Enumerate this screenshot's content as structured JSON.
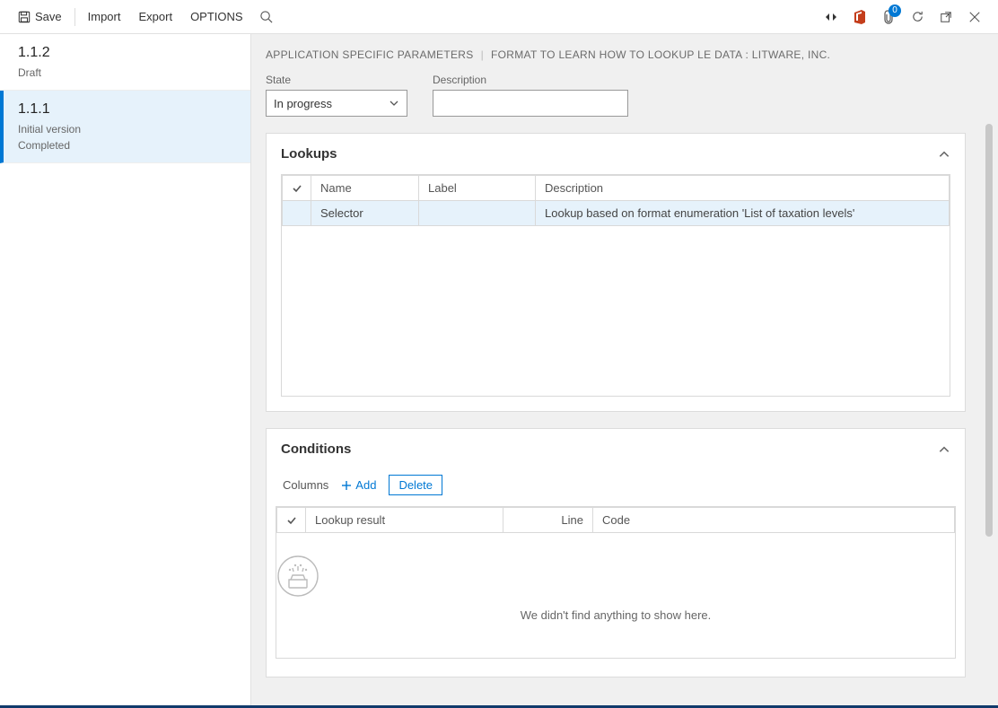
{
  "toolbar": {
    "save": "Save",
    "import": "Import",
    "export": "Export",
    "options": "OPTIONS",
    "badge_count": "0"
  },
  "sidebar": {
    "versions": [
      {
        "title": "1.1.2",
        "line1": "Draft",
        "line2": "",
        "selected": false
      },
      {
        "title": "1.1.1",
        "line1": "Initial version",
        "line2": "Completed",
        "selected": true
      }
    ]
  },
  "breadcrumb": {
    "a": "APPLICATION SPECIFIC PARAMETERS",
    "b": "FORMAT TO LEARN HOW TO LOOKUP LE DATA : LITWARE, INC."
  },
  "form": {
    "state_label": "State",
    "state_value": "In progress",
    "desc_label": "Description",
    "desc_value": ""
  },
  "lookups": {
    "header": "Lookups",
    "cols": {
      "name": "Name",
      "label": "Label",
      "desc": "Description"
    },
    "rows": [
      {
        "name": "Selector",
        "label": "",
        "desc": "Lookup based on format enumeration 'List of taxation levels'",
        "selected": true
      }
    ]
  },
  "conditions": {
    "header": "Conditions",
    "toolbar": {
      "columns": "Columns",
      "add": "Add",
      "delete": "Delete"
    },
    "cols": {
      "result": "Lookup result",
      "line": "Line",
      "code": "Code"
    },
    "empty_msg": "We didn't find anything to show here."
  }
}
